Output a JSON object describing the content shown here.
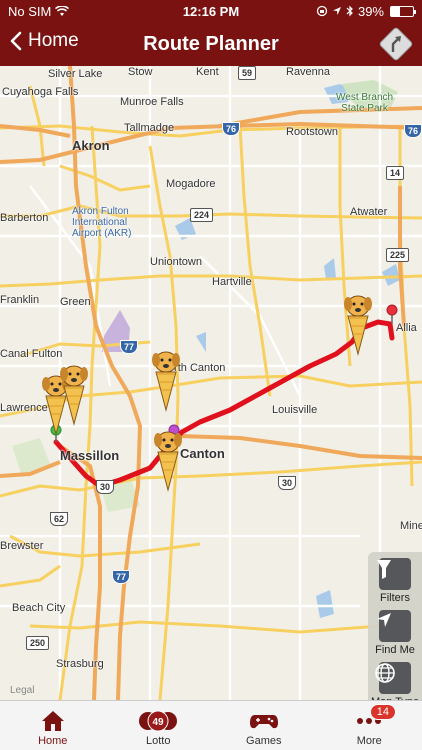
{
  "status": {
    "carrier": "No SIM",
    "time": "12:16 PM",
    "battery": "39%",
    "battery_level": 0.39
  },
  "nav": {
    "back_label": "Home",
    "title": "Route Planner"
  },
  "map": {
    "places": [
      "Silver Lake",
      "Stow",
      "Kent",
      "Ravenna",
      "Cuyahoga Falls",
      "Munroe Falls",
      "West Branch",
      "State Park",
      "Tallmadge",
      "Rootstown",
      "Akron",
      "Mogadore",
      "Akron Fulton",
      "International",
      "Airport (AKR)",
      "Atwater",
      "Barberton",
      "Uniontown",
      "Hartville",
      "Franklin",
      "Green",
      "Allia",
      "Canal Fulton",
      "North Canton",
      "Louisville",
      "Lawrence",
      "Massillon",
      "Canton",
      "Brewster",
      "Beach City",
      "Strasburg",
      "Mine"
    ],
    "shields": [
      "59",
      "76",
      "76",
      "14",
      "224",
      "225",
      "77",
      "62",
      "30",
      "30",
      "77",
      "250"
    ],
    "legal": "Legal"
  },
  "controls": {
    "filters": "Filters",
    "find_me": "Find Me",
    "map_type": "Map Type"
  },
  "tabs": {
    "home": "Home",
    "lotto": "Lotto",
    "lotto_ball": "49",
    "games": "Games",
    "more": "More",
    "more_badge": "14"
  },
  "colors": {
    "brand": "#7a1212",
    "route": "#e0101c",
    "badge": "#d9352d"
  }
}
